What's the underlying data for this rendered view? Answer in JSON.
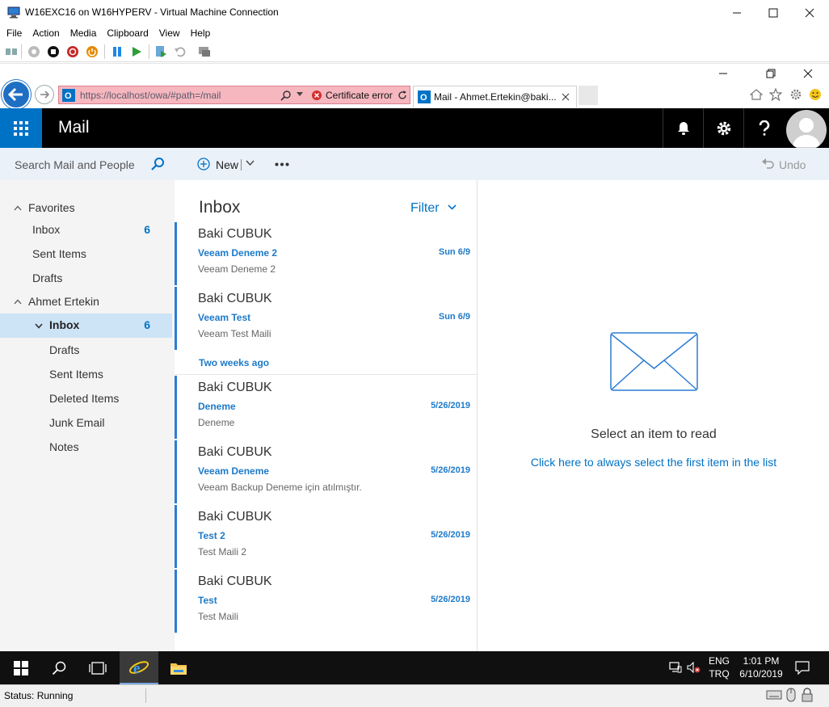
{
  "vm_window": {
    "title": "W16EXC16 on W16HYPERV - Virtual Machine Connection",
    "menu": [
      "File",
      "Action",
      "Media",
      "Clipboard",
      "View",
      "Help"
    ],
    "status": "Status: Running"
  },
  "browser": {
    "url": "https://localhost/owa/#path=/mail",
    "certificate": "Certificate error",
    "tab_title": "Mail - Ahmet.Ertekin@baki..."
  },
  "owa": {
    "app_title": "Mail",
    "search_placeholder": "Search Mail and People",
    "new_label": "New",
    "undo_label": "Undo",
    "accent": "#0072c6"
  },
  "folders": {
    "favorites_label": "Favorites",
    "favorites": [
      {
        "label": "Inbox",
        "count": "6"
      },
      {
        "label": "Sent Items",
        "count": ""
      },
      {
        "label": "Drafts",
        "count": ""
      }
    ],
    "account_label": "Ahmet Ertekin",
    "account_items": [
      {
        "label": "Inbox",
        "count": "6"
      },
      {
        "label": "Drafts",
        "count": ""
      },
      {
        "label": "Sent Items",
        "count": ""
      },
      {
        "label": "Deleted Items",
        "count": ""
      },
      {
        "label": "Junk Email",
        "count": ""
      },
      {
        "label": "Notes",
        "count": ""
      }
    ]
  },
  "message_list": {
    "title": "Inbox",
    "filter_label": "Filter",
    "group_header": "Two weeks ago",
    "messages": [
      {
        "sender": "Baki CUBUK",
        "subject": "Veeam Deneme 2",
        "date": "Sun 6/9",
        "preview": "Veeam Deneme 2"
      },
      {
        "sender": "Baki CUBUK",
        "subject": "Veeam Test",
        "date": "Sun 6/9",
        "preview": "Veeam Test Maili"
      },
      {
        "sender": "Baki CUBUK",
        "subject": "Deneme",
        "date": "5/26/2019",
        "preview": "Deneme"
      },
      {
        "sender": "Baki CUBUK",
        "subject": "Veeam Deneme",
        "date": "5/26/2019",
        "preview": "Veeam Backup Deneme için atılmıştır."
      },
      {
        "sender": "Baki CUBUK",
        "subject": "Test 2",
        "date": "5/26/2019",
        "preview": "Test Maili 2"
      },
      {
        "sender": "Baki CUBUK",
        "subject": "Test",
        "date": "5/26/2019",
        "preview": "Test Maili"
      }
    ]
  },
  "reading_pane": {
    "title": "Select an item to read",
    "link": "Click here to always select the first item in the list"
  },
  "taskbar": {
    "lang_line1": "ENG",
    "lang_line2": "TRQ",
    "time": "1:01 PM",
    "date": "6/10/2019"
  }
}
